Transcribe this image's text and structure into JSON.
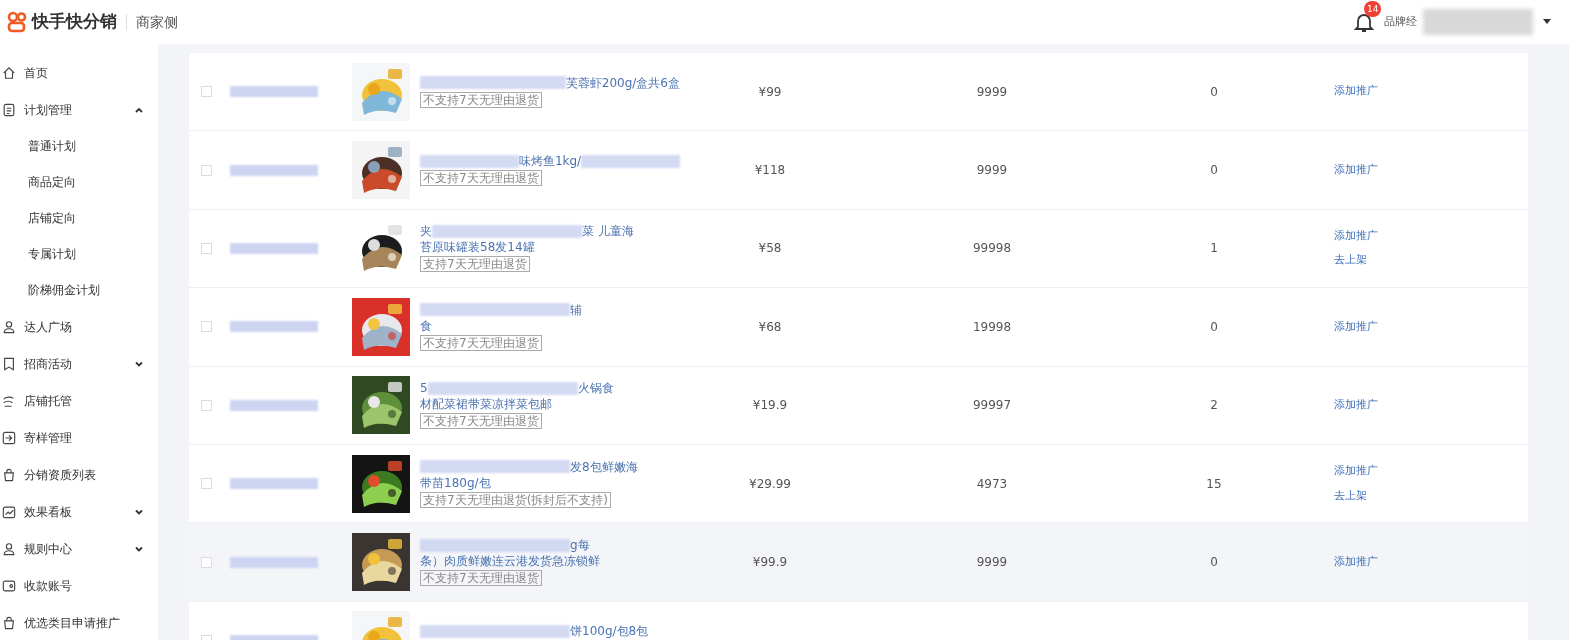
{
  "header": {
    "logo_text": "快手快分销",
    "section": "商家侧",
    "notification_count": "14",
    "user_role": "品牌经"
  },
  "sidebar": {
    "items": [
      {
        "label": "首页",
        "kind": "link"
      },
      {
        "label": "计划管理",
        "kind": "group",
        "expanded": true,
        "children": [
          {
            "label": "普通计划"
          },
          {
            "label": "商品定向"
          },
          {
            "label": "店铺定向"
          },
          {
            "label": "专属计划"
          },
          {
            "label": "阶梯佣金计划"
          }
        ]
      },
      {
        "label": "达人广场",
        "kind": "link"
      },
      {
        "label": "招商活动",
        "kind": "group",
        "expanded": false
      },
      {
        "label": "店铺托管",
        "kind": "link"
      },
      {
        "label": "寄样管理",
        "kind": "link"
      },
      {
        "label": "分销资质列表",
        "kind": "link"
      },
      {
        "label": "效果看板",
        "kind": "group",
        "expanded": false
      },
      {
        "label": "规则中心",
        "kind": "group",
        "expanded": false
      },
      {
        "label": "收款账号",
        "kind": "link"
      },
      {
        "label": "优选类目申请推广",
        "kind": "link"
      }
    ]
  },
  "table": {
    "rows": [
      {
        "checked": false,
        "hovered": false,
        "title_lines": [
          [
            {
              "kind": "redacted"
            },
            {
              "kind": "text",
              "text": "芙蓉虾200g/盒共6盒"
            }
          ]
        ],
        "tag": "不支持7天无理由退货",
        "price": "¥99",
        "stock": "9999",
        "count": "0",
        "actions": [
          "添加推广"
        ]
      },
      {
        "checked": false,
        "hovered": false,
        "title_lines": [
          [
            {
              "kind": "redacted"
            },
            {
              "kind": "text",
              "text": "味烤鱼1kg/"
            },
            {
              "kind": "redacted"
            }
          ]
        ],
        "tag": "不支持7天无理由退货",
        "price": "¥118",
        "stock": "9999",
        "count": "0",
        "actions": [
          "添加推广"
        ]
      },
      {
        "checked": false,
        "hovered": false,
        "title_lines": [
          [
            {
              "kind": "text",
              "text": "夹"
            },
            {
              "kind": "redacted"
            },
            {
              "kind": "text",
              "text": "菜 儿童海"
            }
          ],
          [
            {
              "kind": "text",
              "text": "苔原味罐装58发14罐"
            }
          ]
        ],
        "tag": "支持7天无理由退货",
        "price": "¥58",
        "stock": "99998",
        "count": "1",
        "actions": [
          "添加推广",
          "去上架"
        ]
      },
      {
        "checked": false,
        "hovered": false,
        "title_lines": [
          [
            {
              "kind": "redacted"
            },
            {
              "kind": "text",
              "text": "辅"
            }
          ],
          [
            {
              "kind": "text",
              "text": "食"
            }
          ]
        ],
        "tag": "不支持7天无理由退货",
        "price": "¥68",
        "stock": "19998",
        "count": "0",
        "actions": [
          "添加推广"
        ]
      },
      {
        "checked": false,
        "hovered": false,
        "title_lines": [
          [
            {
              "kind": "text",
              "text": "5"
            },
            {
              "kind": "redacted"
            },
            {
              "kind": "text",
              "text": "火锅食"
            }
          ],
          [
            {
              "kind": "text",
              "text": "材配菜裙带菜凉拌菜包邮"
            }
          ]
        ],
        "tag": "不支持7天无理由退货",
        "price": "¥19.9",
        "stock": "99997",
        "count": "2",
        "actions": [
          "添加推广"
        ]
      },
      {
        "checked": false,
        "hovered": false,
        "title_lines": [
          [
            {
              "kind": "redacted"
            },
            {
              "kind": "text",
              "text": "发8包鲜嫩海"
            }
          ],
          [
            {
              "kind": "text",
              "text": "带苗180g/包"
            }
          ]
        ],
        "tag": "支持7天无理由退货(拆封后不支持)",
        "price": "¥29.99",
        "stock": "4973",
        "count": "15",
        "actions": [
          "添加推广",
          "去上架"
        ]
      },
      {
        "checked": false,
        "hovered": true,
        "title_lines": [
          [
            {
              "kind": "redacted"
            },
            {
              "kind": "text",
              "text": "g每"
            }
          ],
          [
            {
              "kind": "text",
              "text": "条）肉质鲜嫩连云港发货急冻锁鲜"
            }
          ]
        ],
        "tag": "不支持7天无理由退货",
        "price": "¥99.9",
        "stock": "9999",
        "count": "0",
        "actions": [
          "添加推广"
        ]
      },
      {
        "checked": false,
        "hovered": false,
        "title_lines": [
          [
            {
              "kind": "redacted"
            },
            {
              "kind": "text",
              "text": "饼100g/包8包"
            }
          ]
        ]
      }
    ]
  }
}
